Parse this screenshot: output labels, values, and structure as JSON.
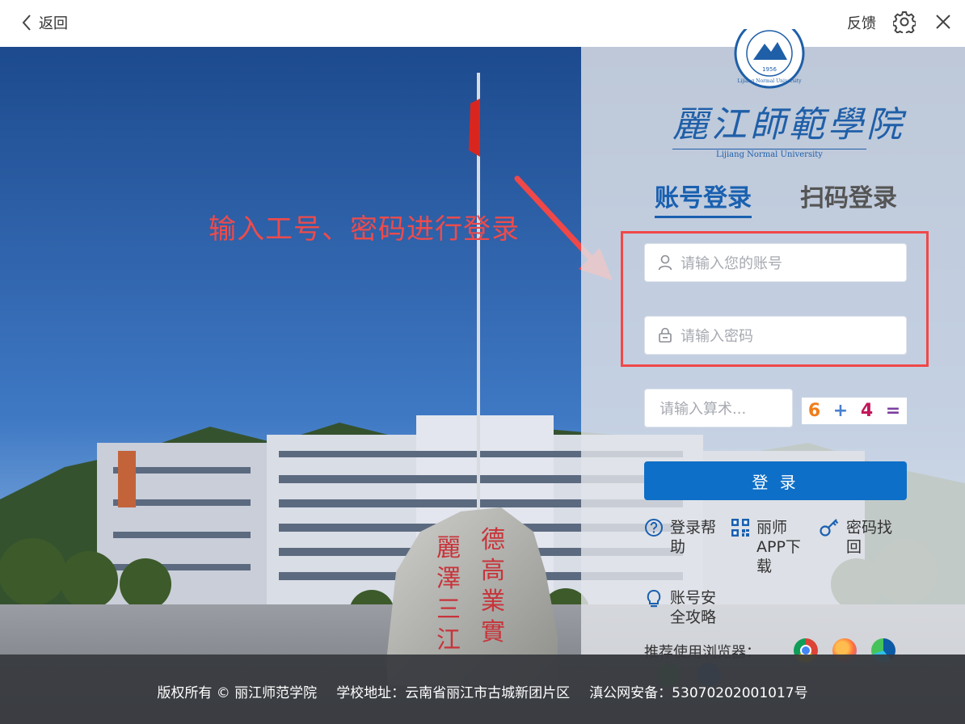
{
  "topbar": {
    "back_label": "返回",
    "feedback_label": "反馈"
  },
  "annotation": {
    "text": "输入工号、密码进行登录",
    "color": "#ee4b4b"
  },
  "logo": {
    "seal_year": "1956",
    "seal_en": "Lijiang Normal University",
    "name_cn": "麗江師範學院",
    "name_en": "Lijiang Normal University"
  },
  "tabs": {
    "account": "账号登录",
    "qrcode": "扫码登录",
    "active": "account"
  },
  "form": {
    "username_placeholder": "请输入您的账号",
    "password_placeholder": "请输入密码",
    "captcha_placeholder": "请输入算术...",
    "captcha": [
      "6",
      "+",
      "4",
      "="
    ],
    "login_label": "登 录"
  },
  "links": {
    "help": "登录帮助",
    "app": "丽师APP下载",
    "recover": "密码找回",
    "safety": "账号安全攻略"
  },
  "browsers": {
    "label": "推荐使用浏览器：",
    "items": [
      "chrome-icon",
      "firefox-icon",
      "edge-icon",
      "360-icon",
      "sogou-icon"
    ]
  },
  "footer": {
    "copyright": "版权所有 © 丽江师范学院",
    "address": "学校地址：云南省丽江市古城新团片区",
    "icp": "滇公网安备：53070202001017号"
  },
  "colors": {
    "accent": "#0e6fc8",
    "tab_active": "#1960b0",
    "annotation_red": "#f04848"
  }
}
